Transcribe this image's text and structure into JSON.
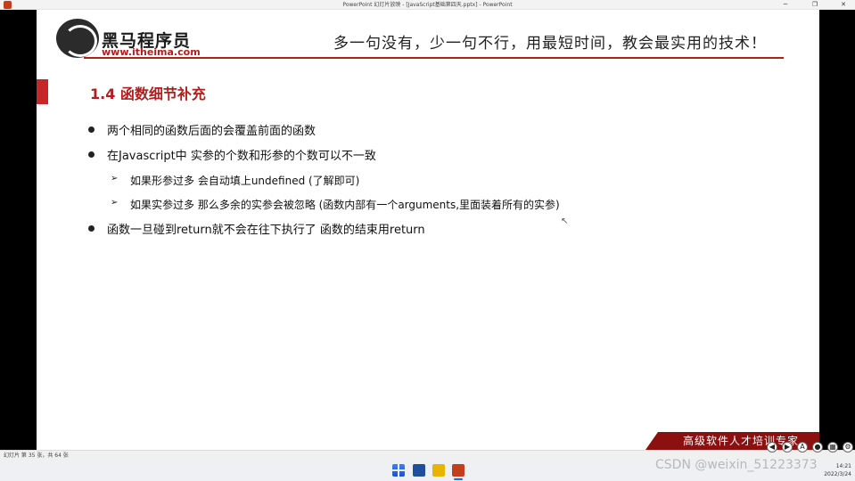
{
  "window": {
    "title": "PowerPoint 幻灯片放映 - [JavaScript基础第四天.pptx] - PowerPoint",
    "minimize": "─",
    "restore": "❐",
    "close": "✕"
  },
  "slide": {
    "brand_name": "黑马程序员",
    "brand_url": "www.itheima.com",
    "slogan": "多一句没有，少一句不行，用最短时间，教会最实用的技术！",
    "title": "1.4 函数细节补充",
    "points": [
      "两个相同的函数后面的会覆盖前面的函数",
      "在Javascript中 实参的个数和形参的个数可以不一致",
      "函数一旦碰到return就不会在往下执行了  函数的结束用return"
    ],
    "sub_points": [
      "如果形参过多 会自动填上undefined (了解即可)",
      "如果实参过多 那么多余的实参会被忽略 (函数内部有一个arguments,里面装着所有的实参)"
    ],
    "footer_banner": "高级软件人才培训专家"
  },
  "status": {
    "slide_counter": "幻灯片 第 35 张，共 64 张"
  },
  "view_tools": {
    "text_tool": "A",
    "slides_tool": "▦",
    "settings": "⚙"
  },
  "taskbar": {
    "time": "14:21",
    "date": "2022/3/24"
  },
  "watermark": "CSDN @weixin_51223373",
  "colors": {
    "accent_red": "#b21d1d",
    "banner_red": "#8c1010"
  }
}
